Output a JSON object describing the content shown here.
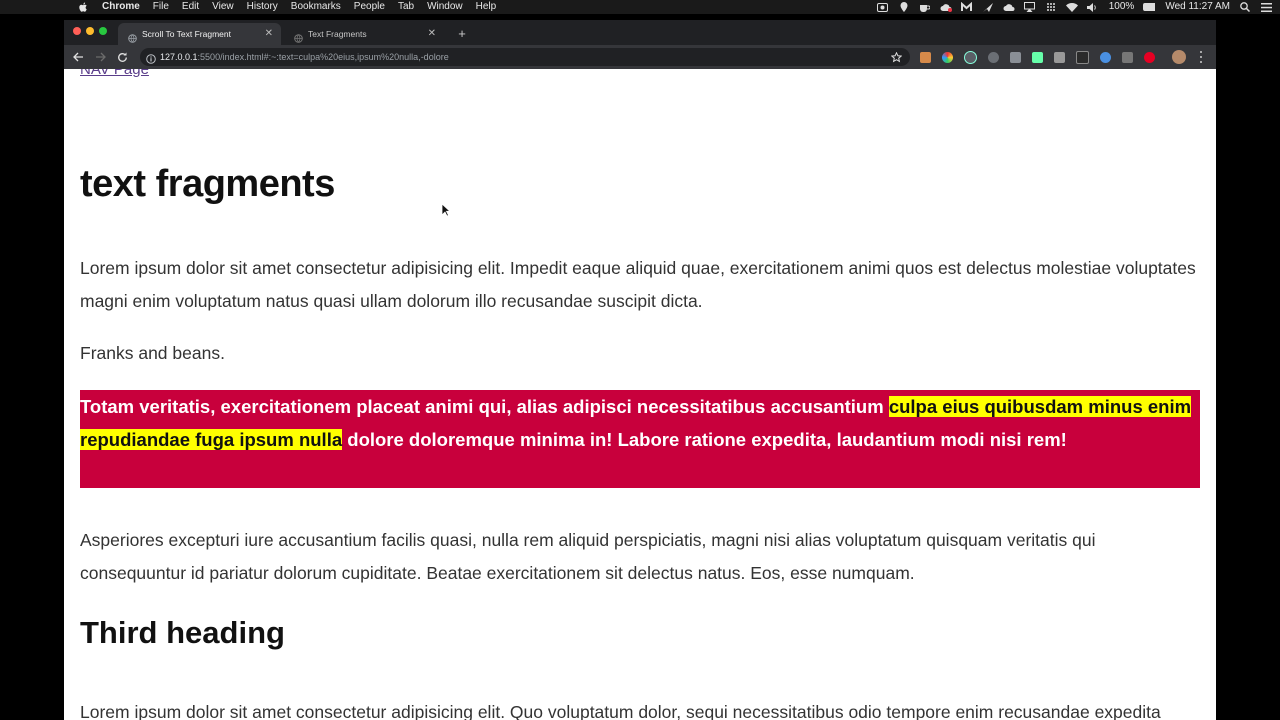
{
  "menubar": {
    "app_name": "Chrome",
    "items": [
      "File",
      "Edit",
      "View",
      "History",
      "Bookmarks",
      "People",
      "Tab",
      "Window",
      "Help"
    ],
    "battery": "100%",
    "clock": "Wed 11:27 AM"
  },
  "tabs": [
    {
      "title": "Scroll To Text Fragment",
      "active": true
    },
    {
      "title": "Text Fragments",
      "active": false
    }
  ],
  "toolbar": {
    "url_host": "127.0.0.1",
    "url_rest": ":5500/index.html#:~:text=culpa%20eius,ipsum%20nulla,-dolore"
  },
  "page": {
    "nav_link": "NAV Page",
    "title": "text fragments",
    "paragraph1": "Lorem ipsum dolor sit amet consectetur adipisicing elit. Impedit eaque aliquid quae, exercitationem animi quos est delectus molestiae voluptates magni enim voluptatum natus quasi ullam dolorum illo recusandae suscipit dicta.",
    "paragraph2": "Franks and beans.",
    "highlight_before": "Totam veritatis, exercitationem placeat animi qui, alias adipisci necessitatibus accusantium ",
    "highlight_marked": "culpa eius quibusdam minus enim repudiandae fuga ipsum nulla",
    "highlight_after": " dolore doloremque minima in! Labore ratione expedita, laudantium modi nisi rem!",
    "paragraph3": "Asperiores excepturi iure accusantium facilis quasi, nulla rem aliquid perspiciatis, magni nisi alias voluptatum quisquam veritatis qui consequuntur id pariatur dolorum cupiditate. Beatae exercitationem sit delectus natus. Eos, esse numquam.",
    "heading2": "Third heading",
    "paragraph4": "Lorem ipsum dolor sit amet consectetur adipisicing elit. Quo voluptatum dolor, sequi necessitatibus odio tempore enim recusandae expedita"
  },
  "colors": {
    "highlight_block": "#c8003c",
    "mark": "#ffff00",
    "link": "#5a3d8a"
  }
}
